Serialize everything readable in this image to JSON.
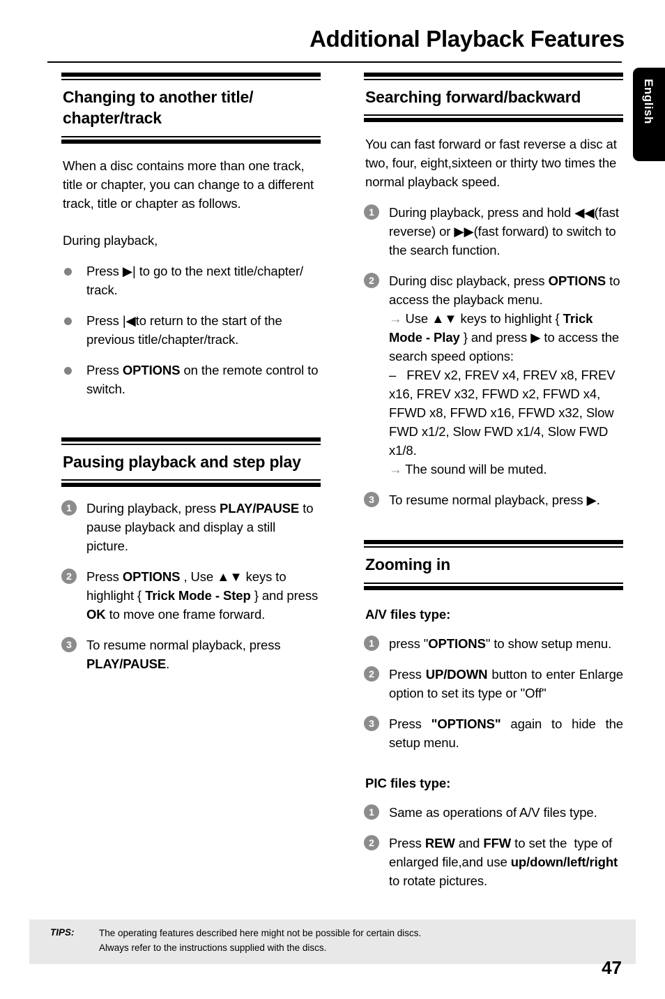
{
  "page": {
    "title": "Additional Playback Features",
    "side_tab_label": "English",
    "page_number": "47",
    "accent_gray": "#8c8c8c",
    "bullet_gray": "#828282",
    "tips_bg": "#e8e8e8"
  },
  "left_column": {
    "sections": [
      {
        "heading": "Changing to another title/ chapter/track",
        "paragraphs": [
          "When a disc contains more than one track, title or chapter, you can change to a different track, title or chapter as follows.",
          "During playback,"
        ],
        "bullets": [
          {
            "marker": "dot",
            "html": "Press ▶| to go to the next title/chapter/ track."
          },
          {
            "marker": "dot",
            "html": "Press |◀to return to the start of the previous title/chapter/track."
          },
          {
            "marker": "dot",
            "html": "Press <b>OPTIONS</b> on the remote control to switch."
          }
        ]
      },
      {
        "heading": "Pausing playback and step play",
        "paragraphs": [],
        "bullets": [
          {
            "marker": "1",
            "html": "During playback, press <b>PLAY/PAUSE</b> to pause playback and display a still picture."
          },
          {
            "marker": "2",
            "html": "Press <b>OPTIONS</b> , Use ▲▼ keys to highlight { <b>Trick Mode - Step</b> } and press <b>OK</b> to move one frame forward."
          },
          {
            "marker": "3",
            "html": "To resume normal playback, press <b>PLAY/PAUSE</b>."
          }
        ]
      }
    ]
  },
  "right_column": {
    "sections": [
      {
        "heading": "Searching forward/backward",
        "paragraphs": [
          "You can fast forward or fast reverse a disc at two, four, eight,sixteen or thirty two times the normal playback speed."
        ],
        "bullets": [
          {
            "marker": "1",
            "html": "During playback, press and hold ◀◀(fast reverse) or ▶▶(fast forward) to switch to the search function."
          },
          {
            "marker": "2",
            "html": "During disc playback, press <b>OPTIONS</b> to access the playback menu.<br><span class=\"arrow\">→</span> Use ▲▼ keys to highlight { <b>Trick Mode - Play</b> } and press ▶ to access the search speed options:<br>–&nbsp;&nbsp; FREV x2, FREV x4, FREV x8, FREV x16, FREV x32, FFWD x2, FFWD x4, FFWD x8, FFWD x16, FFWD x32, Slow FWD x1/2, Slow FWD x1/4, Slow FWD x1/8.<br><span class=\"arrow\">→</span> The sound will be muted."
          },
          {
            "marker": "3",
            "html": "To resume normal playback, press ▶."
          }
        ]
      },
      {
        "heading": "Zooming in",
        "subsections": [
          {
            "sub_heading": "A/V files type:",
            "bullets": [
              {
                "marker": "1",
                "html": "press \"<b>OPTIONS</b>\" to show setup menu."
              },
              {
                "marker": "2",
                "html": "Press <b>UP/DOWN</b> button to enter Enlarge option to set its type or \"Off\"",
                "justify": true
              },
              {
                "marker": "3",
                "html": "Press <b>\"OPTIONS\"</b> again to hide the setup menu.",
                "justify": true
              }
            ]
          },
          {
            "sub_heading": "PIC files type:",
            "bullets": [
              {
                "marker": "1",
                "html": "Same as operations of A/V files type."
              },
              {
                "marker": "2",
                "html": "Press <b>REW</b> and <b>FFW</b> to set the&nbsp; type of enlarged file,and use <b>up/down/left/right</b> to rotate pictures."
              }
            ]
          }
        ]
      }
    ]
  },
  "footer": {
    "tips_label": "TIPS:",
    "tips_line1": "The operating features described here might not be possible for certain discs.",
    "tips_line2": "Always refer to the instructions supplied with the discs."
  }
}
